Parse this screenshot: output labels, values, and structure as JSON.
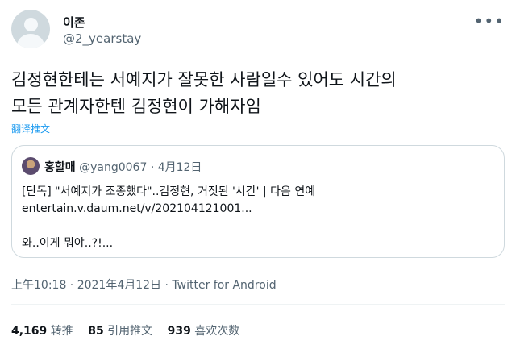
{
  "author": {
    "display_name": "이존",
    "handle": "@2_yearstay"
  },
  "more_icon": "ellipsis-icon",
  "tweet": {
    "text_line1": "김정현한테는 서예지가 잘못한 사람일수 있어도 시간의",
    "text_line2": "모든 관계자한텐 김정현이 가해자임",
    "translate_label": "翻译推文"
  },
  "quoted": {
    "display_name": "홍할매",
    "handle": "@yang0067",
    "date": "· 4月12日",
    "line1": "[단독] \"서예지가 조종했다\"..김정현, 거짓된 '시간' | 다음 연예",
    "line2": "entertain.v.daum.net/v/202104121001...",
    "line3": "와..이게 뭐야..?!..."
  },
  "meta": {
    "timestamp": "上午10:18 · 2021年4月12日 · Twitter for Android"
  },
  "stats": {
    "retweets_count": "4,169",
    "retweets_label": "转推",
    "quotes_count": "85",
    "quotes_label": "引用推文",
    "likes_count": "939",
    "likes_label": "喜欢次数"
  }
}
